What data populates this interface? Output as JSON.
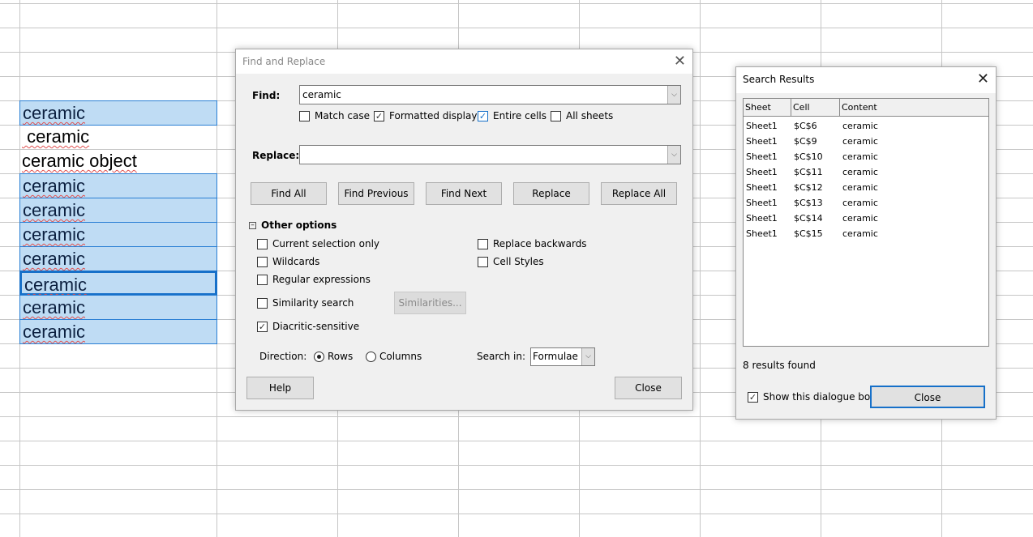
{
  "sheet": {
    "cells": [
      {
        "ref": "C6",
        "text": "ceramic",
        "selected": true
      },
      {
        "ref": "C7",
        "text": " ceramic",
        "selected": false
      },
      {
        "ref": "C8",
        "text": "ceramic object",
        "selected": false
      },
      {
        "ref": "C9",
        "text": "ceramic",
        "selected": true
      },
      {
        "ref": "C10",
        "text": "ceramic",
        "selected": true
      },
      {
        "ref": "C11",
        "text": "ceramic",
        "selected": true
      },
      {
        "ref": "C12",
        "text": "ceramic",
        "selected": true
      },
      {
        "ref": "C13",
        "text": "ceramic",
        "selected": true,
        "active": true
      },
      {
        "ref": "C14",
        "text": "ceramic",
        "selected": true
      },
      {
        "ref": "C15",
        "text": "ceramic",
        "selected": true
      }
    ],
    "selection_color": "#bfdcf4",
    "active_border_color": "#1670c9"
  },
  "find_replace": {
    "title": "Find and Replace",
    "find_label": "Find:",
    "find_value": "ceramic",
    "replace_label": "Replace:",
    "replace_value": "",
    "options": {
      "match_case": {
        "label": "Match case",
        "checked": false
      },
      "formatted_display": {
        "label": "Formatted display",
        "checked": true
      },
      "entire_cells": {
        "label": "Entire cells",
        "checked": true
      },
      "all_sheets": {
        "label": "All sheets",
        "checked": false
      }
    },
    "buttons": {
      "find_all": "Find All",
      "find_previous": "Find Previous",
      "find_next": "Find Next",
      "replace": "Replace",
      "replace_all": "Replace All",
      "help": "Help",
      "close": "Close",
      "similarities": "Similarities..."
    },
    "other_options_label": "Other options",
    "other": {
      "current_selection": {
        "label": "Current selection only",
        "checked": false
      },
      "wildcards": {
        "label": "Wildcards",
        "checked": false
      },
      "regex": {
        "label": "Regular expressions",
        "checked": false
      },
      "similarity": {
        "label": "Similarity search",
        "checked": false
      },
      "diacritic": {
        "label": "Diacritic-sensitive",
        "checked": true
      },
      "replace_backwards": {
        "label": "Replace backwards",
        "checked": false
      },
      "cell_styles": {
        "label": "Cell Styles",
        "checked": false
      }
    },
    "direction_label": "Direction:",
    "rows_label": "Rows",
    "columns_label": "Columns",
    "direction": "Rows",
    "search_in_label": "Search in:",
    "search_in_value": "Formulae"
  },
  "search_results": {
    "title": "Search Results",
    "columns": [
      "Sheet",
      "Cell",
      "Content"
    ],
    "rows": [
      [
        "Sheet1",
        "$C$6",
        "ceramic"
      ],
      [
        "Sheet1",
        "$C$9",
        "ceramic"
      ],
      [
        "Sheet1",
        "$C$10",
        "ceramic"
      ],
      [
        "Sheet1",
        "$C$11",
        "ceramic"
      ],
      [
        "Sheet1",
        "$C$12",
        "ceramic"
      ],
      [
        "Sheet1",
        "$C$13",
        "ceramic"
      ],
      [
        "Sheet1",
        "$C$14",
        "ceramic"
      ],
      [
        "Sheet1",
        "$C$15",
        "ceramic"
      ]
    ],
    "count_text": "8 results found",
    "show_dialog_label": "Show this dialogue box",
    "show_dialog_checked": true,
    "close_label": "Close"
  }
}
